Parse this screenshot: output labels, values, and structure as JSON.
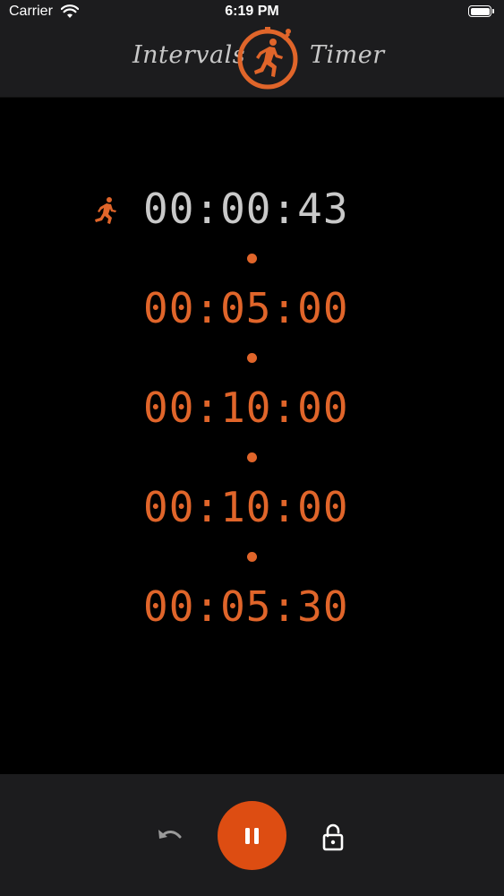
{
  "status_bar": {
    "carrier": "Carrier",
    "time": "6:19 PM"
  },
  "header": {
    "title_left": "Intervals",
    "title_right": "Timer"
  },
  "timers": [
    {
      "value": "00:00:43",
      "state": "active"
    },
    {
      "value": "00:05:00",
      "state": "pending"
    },
    {
      "value": "00:10:00",
      "state": "pending"
    },
    {
      "value": "00:10:00",
      "state": "pending"
    },
    {
      "value": "00:05:30",
      "state": "pending"
    }
  ],
  "colors": {
    "accent": "#e0652a",
    "button": "#dd4d12",
    "active_text": "#c9c9c9",
    "bar_bg": "#1c1c1e",
    "background": "#000000"
  },
  "toolbar": {
    "undo_icon": "undo-icon",
    "pause_icon": "pause-icon",
    "lock_icon": "unlock-icon"
  }
}
